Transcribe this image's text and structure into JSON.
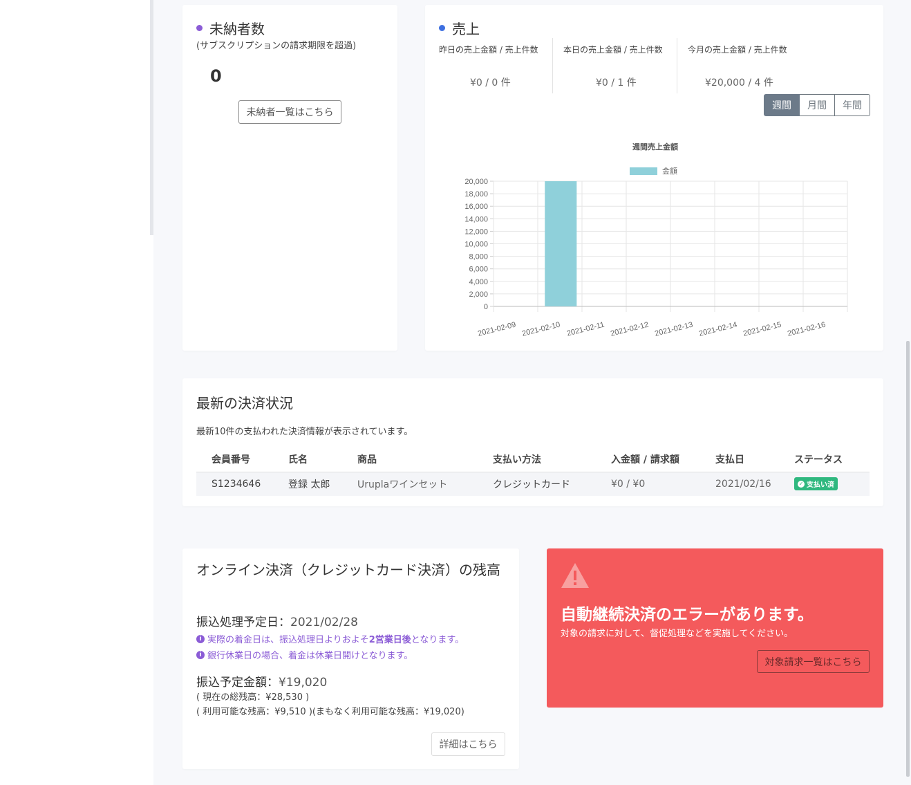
{
  "unpaid": {
    "title": "未納者数",
    "subtitle": "(サブスクリプションの請求期限を超過)",
    "count": "0",
    "list_button": "未納者一覧はこちら",
    "dot_color": "#8b5cd6"
  },
  "sales": {
    "title": "売上",
    "dot_color": "#3d6fe0",
    "stats": [
      {
        "label": "昨日の売上金額 / 売上件数",
        "value": "¥0 / 0 件"
      },
      {
        "label": "本日の売上金額 / 売上件数",
        "value": "¥0 / 1 件"
      },
      {
        "label": "今月の売上金額 / 売上件数",
        "value": "¥20,000 / 4 件"
      }
    ],
    "periods": [
      "週間",
      "月間",
      "年間"
    ],
    "active_period": "週間"
  },
  "chart_data": {
    "type": "bar",
    "title": "週間売上金額",
    "categories": [
      "2021-02-09",
      "2021-02-10",
      "2021-02-11",
      "2021-02-12",
      "2021-02-13",
      "2021-02-14",
      "2021-02-15",
      "2021-02-16"
    ],
    "series": [
      {
        "name": "金額",
        "values": [
          0,
          20000,
          0,
          0,
          0,
          0,
          0,
          0
        ],
        "color": "#8fd0da"
      }
    ],
    "ylim": [
      0,
      20000
    ],
    "yticks": [
      0,
      2000,
      4000,
      6000,
      8000,
      10000,
      12000,
      14000,
      16000,
      18000,
      20000
    ],
    "ytick_labels": [
      "0",
      "2,000",
      "4,000",
      "6,000",
      "8,000",
      "10,000",
      "12,000",
      "14,000",
      "16,000",
      "18,000",
      "20,000"
    ],
    "legend": "top",
    "grid": true
  },
  "payments": {
    "title": "最新の決済状況",
    "description": "最新10件の支払われた決済情報が表示されています。",
    "columns": [
      "会員番号",
      "氏名",
      "商品",
      "支払い方法",
      "入金額 / 請求額",
      "支払日",
      "ステータス"
    ],
    "rows": [
      {
        "member_id": "S1234646",
        "name": "登録 太郎",
        "product": "Uruplaワインセット",
        "method": "クレジットカード",
        "amount": "¥0 / ¥0",
        "date": "2021/02/16",
        "status": "支払い済"
      }
    ]
  },
  "balance": {
    "title": "オンライン決済（クレジットカード決済）の残高",
    "transfer_date_label": "振込処理予定日：",
    "transfer_date": "2021/02/28",
    "note1_pre": "実際の着金日は、振込処理日よりおよそ",
    "note1_bold": "2営業日後",
    "note1_post": "となります。",
    "note2": "銀行休業日の場合、着金は休業日開けとなります。",
    "amount_label": "振込予定金額：",
    "amount": "¥19,020",
    "total_balance": "( 現在の総残高：¥28,530 )",
    "available_balance": "( 利用可能な残高：¥9,510 )(まもなく利用可能な残高：¥19,020)",
    "detail_button": "詳細はこちら"
  },
  "error": {
    "title": "自動継続決済のエラーがあります。",
    "message": "対象の請求に対して、督促処理などを実施してください。",
    "button": "対象請求一覧はこちら",
    "color": "#f45a5c"
  }
}
